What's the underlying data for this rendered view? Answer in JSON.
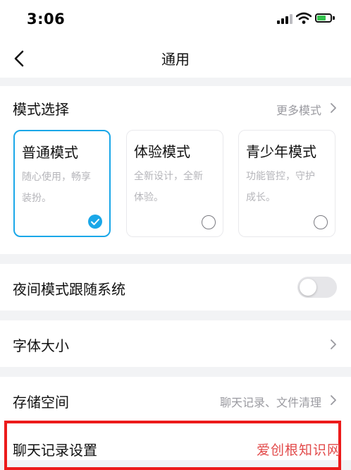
{
  "status_bar": {
    "time": "3:06",
    "signal_icon": "signal-bars-icon",
    "wifi_icon": "wifi-icon",
    "battery_icon": "battery-charging-icon"
  },
  "nav": {
    "back_icon": "back-chevron-icon",
    "title": "通用"
  },
  "mode_section": {
    "label": "模式选择",
    "more_label": "更多模式",
    "modes": [
      {
        "title": "普通模式",
        "desc_line1": "随心使用，畅享",
        "desc_line2": "装扮。",
        "selected": true
      },
      {
        "title": "体验模式",
        "desc_line1": "全新设计，全新",
        "desc_line2": "体验。",
        "selected": false
      },
      {
        "title": "青少年模式",
        "desc_line1": "功能管控，守护",
        "desc_line2": "成长。",
        "selected": false
      }
    ]
  },
  "night_mode": {
    "label": "夜间模式跟随系统",
    "enabled": false
  },
  "font_size": {
    "label": "字体大小"
  },
  "storage": {
    "label": "存储空间",
    "value": "聊天记录、文件清理"
  },
  "chat_history": {
    "label": "聊天记录设置"
  },
  "watermark": {
    "text": "爱创根知识网"
  },
  "colors": {
    "accent": "#1aa7e8",
    "highlight_box": "#ec1b1b",
    "background": "#f2f3f5"
  }
}
